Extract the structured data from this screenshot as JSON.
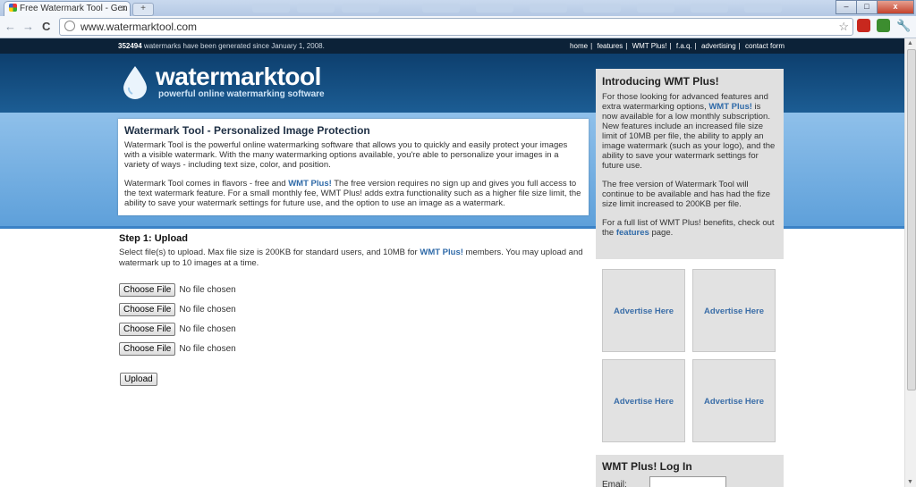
{
  "browser": {
    "tab_title": "Free Watermark Tool - Gen",
    "tab_close": "x",
    "new_tab": "+",
    "url": "www.watermarktool.com",
    "back": "←",
    "forward": "→",
    "reload": "C",
    "star": "☆",
    "minimize": "–",
    "maximize": "□",
    "close": "x"
  },
  "topbar": {
    "count": "352494",
    "count_suffix": " watermarks have been generated since January 1, 2008.",
    "links": [
      "home",
      "features",
      "WMT Plus!",
      "f.a.q.",
      "advertising",
      "contact form"
    ]
  },
  "header": {
    "logo": "watermarktool",
    "tagline": "powerful online watermarking software"
  },
  "intro": {
    "title": "Watermark Tool - Personalized Image Protection",
    "p1": "Watermark Tool is the powerful online watermarking software that allows you to quickly and easily protect your images with a visible watermark. With the many watermarking options available, you're able to personalize your images in a variety of ways - including text size, color, and position.",
    "p2_a": "Watermark Tool comes in flavors - free and ",
    "p2_link": "WMT Plus!",
    "p2_b": " The free version requires no sign up and gives you full access to the text watermark feature. For a small monthly fee, WMT Plus! adds extra functionality such as a higher file size limit, the ability to save your watermark settings for future use, and the option to use an image as a watermark."
  },
  "step1": {
    "title": "Step 1: Upload",
    "text_a": "Select file(s) to upload. Max file size is 200KB for standard users, and 10MB for ",
    "text_link": "WMT Plus!",
    "text_b": " members. You may upload and watermark up to 10 images at a time.",
    "files": [
      {
        "button": "Choose File",
        "status": "No file chosen"
      },
      {
        "button": "Choose File",
        "status": "No file chosen"
      },
      {
        "button": "Choose File",
        "status": "No file chosen"
      },
      {
        "button": "Choose File",
        "status": "No file chosen"
      }
    ],
    "upload_label": "Upload"
  },
  "sidebar": {
    "title": "Introducing WMT Plus!",
    "p1_a": "For those looking for advanced features and extra watermarking options, ",
    "p1_link": "WMT Plus!",
    "p1_b": " is now available for a low monthly subscription. New features include an increased file size limit of 10MB per file, the ability to apply an image watermark (such as your logo), and the ability to save your watermark settings for future use.",
    "p2": "The free version of Watermark Tool will continue to be available and has had the fize size limit increased to 200KB per file.",
    "p3_a": "For a full list of WMT Plus! benefits, check out the ",
    "p3_link": "features",
    "p3_b": " page.",
    "ads": [
      "Advertise Here",
      "Advertise Here",
      "Advertise Here",
      "Advertise Here"
    ],
    "login_title": "WMT Plus! Log In",
    "email_label": "Email:"
  }
}
